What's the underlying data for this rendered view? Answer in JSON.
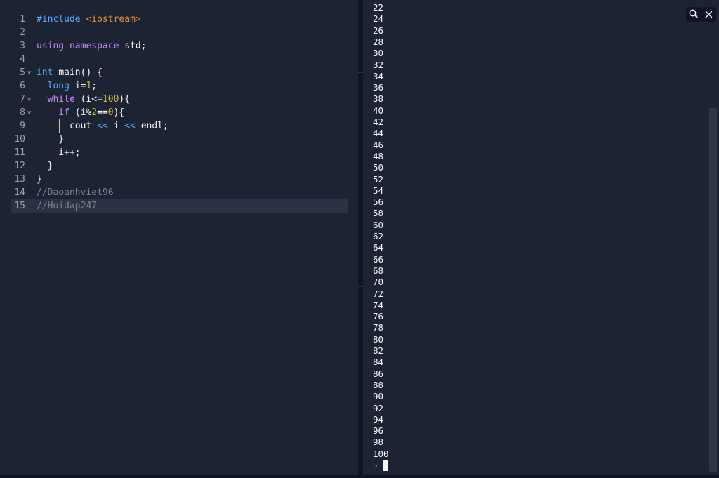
{
  "editor": {
    "lines": [
      {
        "n": "1",
        "parts": [
          {
            "t": "#include ",
            "c": "k-blue"
          },
          {
            "t": "<iostream>",
            "c": "k-orange"
          }
        ]
      },
      {
        "n": "2",
        "parts": []
      },
      {
        "n": "3",
        "parts": [
          {
            "t": "using ",
            "c": "k-purple"
          },
          {
            "t": "namespace ",
            "c": "k-purple"
          },
          {
            "t": "std;",
            "c": ""
          }
        ]
      },
      {
        "n": "4",
        "parts": []
      },
      {
        "n": "5",
        "fold": true,
        "parts": [
          {
            "t": "int ",
            "c": "k-blue"
          },
          {
            "t": "main() {",
            "c": ""
          }
        ]
      },
      {
        "n": "6",
        "parts": [
          {
            "t": "  long ",
            "c": "k-blue"
          },
          {
            "t": "i=",
            "c": ""
          },
          {
            "t": "1",
            "c": "k-num"
          },
          {
            "t": ";",
            "c": ""
          }
        ]
      },
      {
        "n": "7",
        "fold": true,
        "parts": [
          {
            "t": "  while ",
            "c": "k-purple"
          },
          {
            "t": "(i<=",
            "c": ""
          },
          {
            "t": "100",
            "c": "k-num"
          },
          {
            "t": "){",
            "c": ""
          }
        ]
      },
      {
        "n": "8",
        "fold": true,
        "parts": [
          {
            "t": "    if ",
            "c": "k-purple"
          },
          {
            "t": "(i%",
            "c": ""
          },
          {
            "t": "2",
            "c": "k-num"
          },
          {
            "t": "==",
            "c": ""
          },
          {
            "t": "0",
            "c": "k-num"
          },
          {
            "t": "){",
            "c": ""
          }
        ]
      },
      {
        "n": "9",
        "parts": [
          {
            "t": "      cout ",
            "c": ""
          },
          {
            "t": "<<",
            "c": "k-blue"
          },
          {
            "t": " i ",
            "c": ""
          },
          {
            "t": "<<",
            "c": "k-blue"
          },
          {
            "t": " endl;",
            "c": ""
          }
        ]
      },
      {
        "n": "10",
        "parts": [
          {
            "t": "    }",
            "c": ""
          }
        ]
      },
      {
        "n": "11",
        "parts": [
          {
            "t": "    i++;",
            "c": ""
          }
        ]
      },
      {
        "n": "12",
        "parts": [
          {
            "t": "  }",
            "c": ""
          }
        ]
      },
      {
        "n": "13",
        "parts": [
          {
            "t": "}",
            "c": ""
          }
        ]
      },
      {
        "n": "14",
        "parts": [
          {
            "t": "//Daoanhviet96",
            "c": "k-comment"
          }
        ]
      },
      {
        "n": "15",
        "active": true,
        "parts": [
          {
            "t": "//Hoidap247",
            "c": "k-comment"
          }
        ]
      }
    ]
  },
  "console": {
    "output": [
      "22",
      "24",
      "26",
      "28",
      "30",
      "32",
      "34",
      "36",
      "38",
      "40",
      "42",
      "44",
      "46",
      "48",
      "50",
      "52",
      "54",
      "56",
      "58",
      "60",
      "62",
      "64",
      "66",
      "68",
      "70",
      "72",
      "74",
      "76",
      "78",
      "80",
      "82",
      "84",
      "86",
      "88",
      "90",
      "92",
      "94",
      "96",
      "98",
      "100"
    ],
    "prompt_glyph": "›"
  },
  "icons": {
    "search": "search-icon",
    "close": "close-icon",
    "fold": "chevron-down-icon"
  },
  "colors": {
    "background": "#1c2333",
    "keyword_blue": "#57abff",
    "keyword_purple": "#c98af7",
    "string_orange": "#e58f3a",
    "number_yellow": "#cab33b",
    "comment_gray": "#7b8394"
  }
}
